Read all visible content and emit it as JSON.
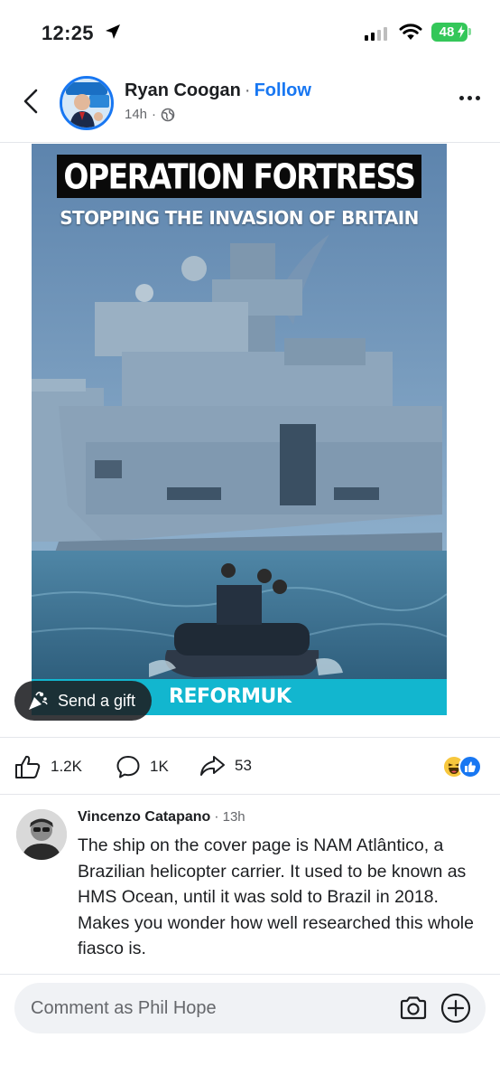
{
  "status_bar": {
    "time": "12:25",
    "battery": "48"
  },
  "post": {
    "author_name": "Ryan Coogan",
    "separator": "·",
    "follow_label": "Follow",
    "time_ago": "14h",
    "meta_dot": "·",
    "image": {
      "headline": "OPERATION FORTRESS",
      "subheadline": "STOPPING THE INVASION OF BRITAIN",
      "brand": "REFORMUK"
    },
    "gift_label": "Send a gift"
  },
  "reactions": {
    "likes": "1.2K",
    "comments": "1K",
    "shares": "53"
  },
  "comment": {
    "author": "Vincenzo Catapano",
    "separator": "·",
    "time_ago": "13h",
    "text": "The ship on the cover page is NAM Atlântico, a Brazilian helicopter carrier. It used to be known as HMS Ocean, until it was sold to Brazil in 2018. Makes you wonder how well researched this whole fiasco is."
  },
  "composer": {
    "placeholder": "Comment as Phil Hope"
  },
  "colors": {
    "accent": "#1877f2",
    "reform_teal": "#12b6cf",
    "battery_green": "#34c759"
  },
  "icons": [
    "location-arrow-icon",
    "signal-icon",
    "wifi-icon",
    "battery-icon",
    "back-chevron-icon",
    "globe-icon",
    "more-dots-icon",
    "gift-icon",
    "like-icon",
    "comment-icon",
    "share-icon",
    "haha-reaction-icon",
    "like-reaction-icon",
    "camera-icon",
    "plus-icon"
  ]
}
